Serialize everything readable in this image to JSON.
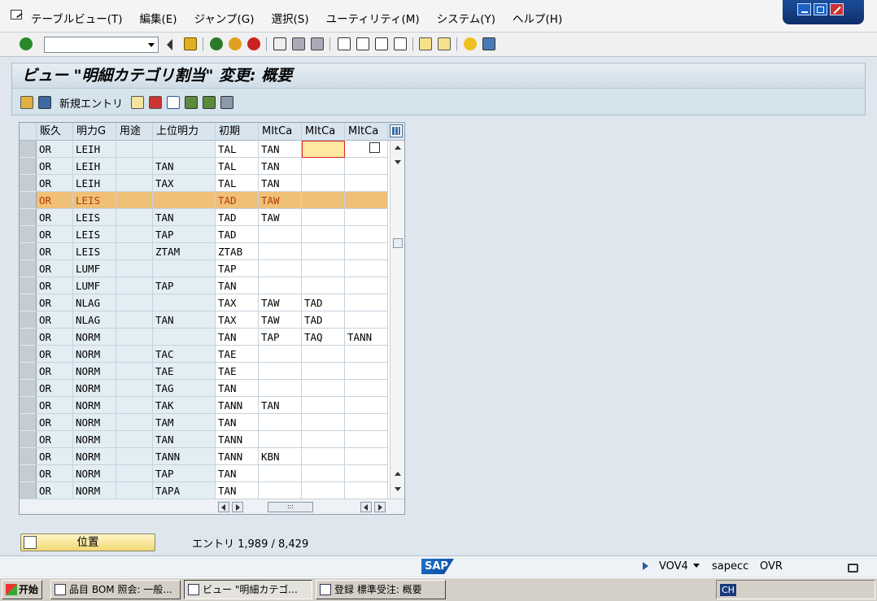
{
  "menu": [
    "テーブルビュー(T)",
    "編集(E)",
    "ジャンプ(G)",
    "選択(S)",
    "ユーティリティ(M)",
    "システム(Y)",
    "ヘルプ(H)"
  ],
  "title": "ビュー \"明細カテゴリ割当\" 変更: 概要",
  "app_toolbar": {
    "new_entries": "新規エントリ"
  },
  "table": {
    "headers": [
      "販久",
      "明力G",
      "用途",
      "上位明力",
      "初期",
      "MItCa",
      "MItCa",
      "MItCa"
    ],
    "rows": [
      [
        "OR",
        "LEIH",
        "",
        "",
        "TAL",
        "TAN",
        "",
        ""
      ],
      [
        "OR",
        "LEIH",
        "",
        "TAN",
        "TAL",
        "TAN",
        "",
        ""
      ],
      [
        "OR",
        "LEIH",
        "",
        "TAX",
        "TAL",
        "TAN",
        "",
        ""
      ],
      [
        "OR",
        "LEIS",
        "",
        "",
        "TAD",
        "TAW",
        "",
        ""
      ],
      [
        "OR",
        "LEIS",
        "",
        "TAN",
        "TAD",
        "TAW",
        "",
        ""
      ],
      [
        "OR",
        "LEIS",
        "",
        "TAP",
        "TAD",
        "",
        "",
        ""
      ],
      [
        "OR",
        "LEIS",
        "",
        "ZTAM",
        "ZTAB",
        "",
        "",
        ""
      ],
      [
        "OR",
        "LUMF",
        "",
        "",
        "TAP",
        "",
        "",
        ""
      ],
      [
        "OR",
        "LUMF",
        "",
        "TAP",
        "TAN",
        "",
        "",
        ""
      ],
      [
        "OR",
        "NLAG",
        "",
        "",
        "TAX",
        "TAW",
        "TAD",
        ""
      ],
      [
        "OR",
        "NLAG",
        "",
        "TAN",
        "TAX",
        "TAW",
        "TAD",
        ""
      ],
      [
        "OR",
        "NORM",
        "",
        "",
        "TAN",
        "TAP",
        "TAQ",
        "TANN"
      ],
      [
        "OR",
        "NORM",
        "",
        "TAC",
        "TAE",
        "",
        "",
        ""
      ],
      [
        "OR",
        "NORM",
        "",
        "TAE",
        "TAE",
        "",
        "",
        ""
      ],
      [
        "OR",
        "NORM",
        "",
        "TAG",
        "TAN",
        "",
        "",
        ""
      ],
      [
        "OR",
        "NORM",
        "",
        "TAK",
        "TANN",
        "TAN",
        "",
        ""
      ],
      [
        "OR",
        "NORM",
        "",
        "TAM",
        "TAN",
        "",
        "",
        ""
      ],
      [
        "OR",
        "NORM",
        "",
        "TAN",
        "TANN",
        "",
        "",
        ""
      ],
      [
        "OR",
        "NORM",
        "",
        "TANN",
        "TANN",
        "KBN",
        "",
        ""
      ],
      [
        "OR",
        "NORM",
        "",
        "TAP",
        "TAN",
        "",
        "",
        ""
      ],
      [
        "OR",
        "NORM",
        "",
        "TAPA",
        "TAN",
        "",
        "",
        ""
      ]
    ],
    "highlighted_row": 3
  },
  "position_button": "位置",
  "entries_text": "エントリ 1,989 / 8,429",
  "status": {
    "sap": "SAP",
    "transaction": "VOV4",
    "server": "sapecc",
    "mode": "OVR"
  },
  "taskbar": {
    "start": "开始",
    "items": [
      "品目 BOM 照会: 一般...",
      "ビュー \"明細カテゴ...",
      "登録 標準受注: 概要"
    ],
    "tray": "CH"
  },
  "colors": {
    "highlight": "#f0c078",
    "title_bg": "#d5e3ec",
    "accent": "#0a4a9e"
  }
}
